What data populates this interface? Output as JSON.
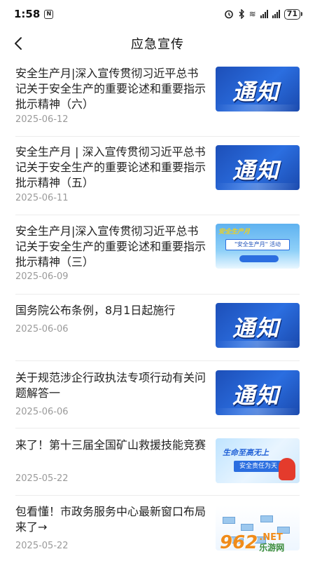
{
  "status_bar": {
    "time": "1:58",
    "nfc_glyph": "N",
    "wifi_glyph": "≋",
    "battery": "71",
    "icons": [
      "nfc-icon",
      "alarm-icon",
      "bluetooth-icon",
      "wifi-icon",
      "signal-icon",
      "battery-icon"
    ]
  },
  "header": {
    "title": "应急宣传",
    "back_icon": "chevron-left-icon"
  },
  "articles": [
    {
      "title": "安全生产月|深入宣传贯彻习近平总书记关于安全生产的重要论述和重要指示批示精神（六）",
      "date": "2025-06-12",
      "thumb": "notice",
      "thumb_text": "通知"
    },
    {
      "title": "安全生产月 | 深入宣传贯彻习近平总书记关于安全生产的重要论述和重要指示批示精神（五）",
      "date": "2025-06-11",
      "thumb": "notice",
      "thumb_text": "通知"
    },
    {
      "title": "安全生产月|深入宣传贯彻习近平总书记关于安全生产的重要论述和重要指示批示精神（三）",
      "date": "2025-06-09",
      "thumb": "safety-month",
      "thumb_text": "\"安全生产月\" 活动",
      "thumb_tag": "安全生产月"
    },
    {
      "title": "国务院公布条例，8月1日起施行",
      "date": "2025-06-06",
      "thumb": "notice",
      "thumb_text": "通知"
    },
    {
      "title": "关于规范涉企行政执法专项行动有关问题解答一",
      "date": "2025-06-06",
      "thumb": "notice",
      "thumb_text": "通知"
    },
    {
      "title": "来了！第十三届全国矿山救援技能竞赛",
      "date": "2025-05-22",
      "thumb": "mine-rescue",
      "thumb_text": "生命至高无上",
      "thumb_sub": "安全责任为天"
    },
    {
      "title": "包看懂！市政务服务中心最新窗口布局来了→",
      "date": "2025-05-22",
      "thumb": "office-map"
    }
  ],
  "watermark": {
    "logo": "962",
    "net": ".NET",
    "cn": "乐游网"
  },
  "colors": {
    "notice_blue": "#2b6ee0",
    "date_gray": "#9a9a9a",
    "divider": "#ececec"
  }
}
